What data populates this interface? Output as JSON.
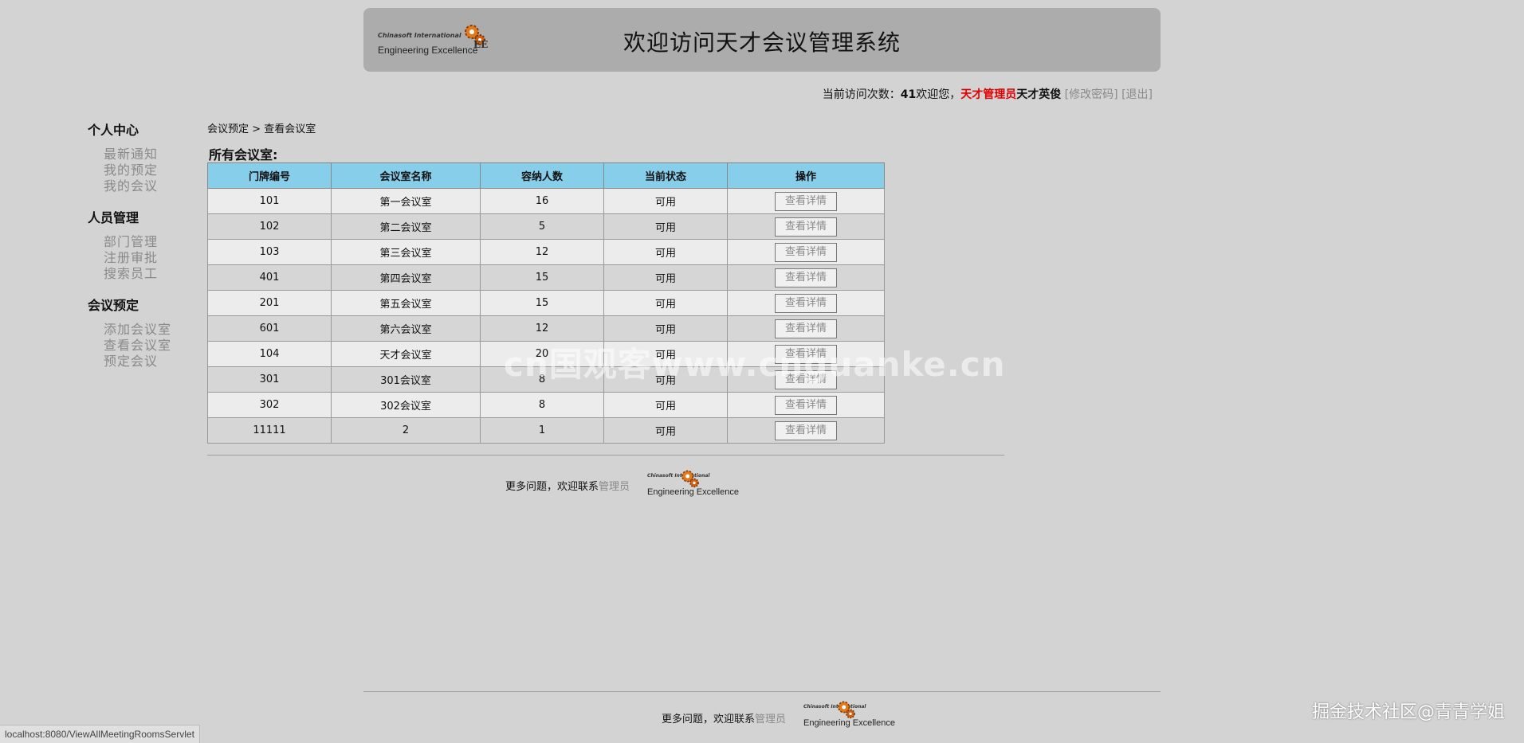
{
  "header": {
    "title": "欢迎访问天才会议管理系统",
    "logo_company": "Chinasoft International",
    "logo_tagline": "Engineering Excellence"
  },
  "userbar": {
    "visit_label": "当前访问次数：",
    "visit_count": "41",
    "welcome": "欢迎您，",
    "role": "天才管理员",
    "username": "天才英俊",
    "change_password": "[修改密码]",
    "logout": "[退出]"
  },
  "sidebar": {
    "groups": [
      {
        "title": "个人中心",
        "items": [
          "最新通知",
          "我的预定",
          "我的会议"
        ]
      },
      {
        "title": "人员管理",
        "items": [
          "部门管理",
          "注册审批",
          "搜索员工"
        ]
      },
      {
        "title": "会议预定",
        "items": [
          "添加会议室",
          "查看会议室",
          "预定会议"
        ]
      }
    ]
  },
  "breadcrumb": {
    "parent": "会议预定",
    "separator": ">",
    "current": "查看会议室"
  },
  "section_title": "所有会议室:",
  "table": {
    "headers": [
      "门牌编号",
      "会议室名称",
      "容纳人数",
      "当前状态",
      "操作"
    ],
    "action_label": "查看详情",
    "rows": [
      [
        "101",
        "第一会议室",
        "16",
        "可用"
      ],
      [
        "102",
        "第二会议室",
        "5",
        "可用"
      ],
      [
        "103",
        "第三会议室",
        "12",
        "可用"
      ],
      [
        "401",
        "第四会议室",
        "15",
        "可用"
      ],
      [
        "201",
        "第五会议室",
        "15",
        "可用"
      ],
      [
        "601",
        "第六会议室",
        "12",
        "可用"
      ],
      [
        "104",
        "天才会议室",
        "20",
        "可用"
      ],
      [
        "301",
        "301会议室",
        "8",
        "可用"
      ],
      [
        "302",
        "302会议室",
        "8",
        "可用"
      ],
      [
        "11111",
        "2",
        "1",
        "可用"
      ]
    ]
  },
  "footer": {
    "text": "更多问题，欢迎联系",
    "link": "管理员"
  },
  "statusbar": {
    "url": "localhost:8080/ViewAllMeetingRoomsServlet"
  },
  "watermarks": {
    "center": "cn国观客www.cnguanke.cn",
    "corner": "掘金技术社区@青青学姐"
  },
  "colors": {
    "background": "#d3d3d3",
    "header_bg": "#acacac",
    "table_header_bg": "#87ceeb",
    "role_color": "#e00000",
    "link_gray": "#8a8a8a"
  }
}
